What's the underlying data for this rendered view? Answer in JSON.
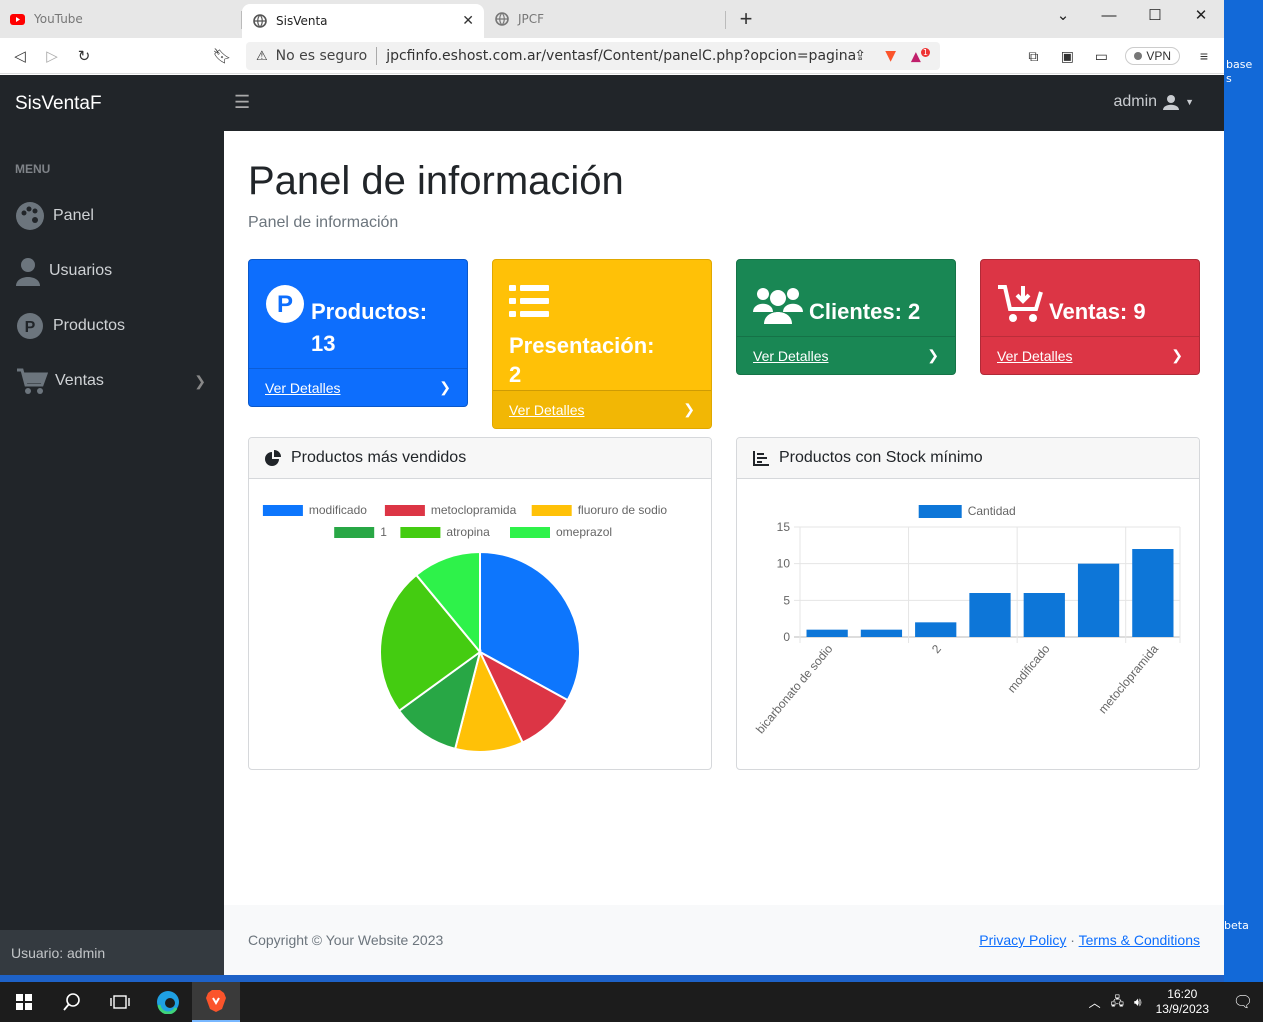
{
  "desktop": {
    "label_top": "base",
    "label_top2": "s",
    "label_bottom": "beta"
  },
  "browser": {
    "tabs": [
      {
        "title": "YouTube",
        "icon": "youtube-icon"
      },
      {
        "title": "SisVenta",
        "icon": "globe-icon",
        "active": true
      },
      {
        "title": "JPCF",
        "icon": "globe-icon"
      }
    ],
    "security_label": "No es seguro",
    "url": "jpcfinfo.eshost.com.ar/ventasf/Content/panelC.php?opcion=pagina",
    "vpn_label": "VPN",
    "notification_count": "1"
  },
  "sidebar": {
    "brand": "SisVentaF",
    "menu_heading": "MENU",
    "items": [
      {
        "label": "Panel",
        "icon": "palette-icon"
      },
      {
        "label": "Usuarios",
        "icon": "user-icon"
      },
      {
        "label": "Productos",
        "icon": "product-p-icon"
      },
      {
        "label": "Ventas",
        "icon": "cart-icon"
      }
    ],
    "footer": "Usuario: admin"
  },
  "topnav": {
    "user": "admin"
  },
  "main": {
    "title": "Panel de información",
    "subtitle": "Panel de información",
    "cards": [
      {
        "label": "Productos: 13",
        "link": "Ver Detalles",
        "color": "#0d6efd"
      },
      {
        "label": "Presentación:",
        "label2": "2",
        "link": "Ver Detalles",
        "color": "#ffc107"
      },
      {
        "label": "Clientes: 2",
        "link": "Ver Detalles",
        "color": "#198754"
      },
      {
        "label": "Ventas: 9",
        "link": "Ver Detalles",
        "color": "#dc3545"
      }
    ],
    "pie_title": "Productos más vendidos",
    "bar_title": "Productos con Stock mínimo"
  },
  "chart_data": [
    {
      "type": "pie",
      "legend_position": "top",
      "categories": [
        "modificado",
        "metoclopramida",
        "fluoruro de sodio",
        "1",
        "atropina",
        "omeprazol"
      ],
      "values": [
        33,
        10,
        11,
        11,
        24,
        11
      ],
      "colors": [
        "#0d76fd",
        "#dc3545",
        "#ffc107",
        "#28a745",
        "#44cc11",
        "#2ef24a"
      ]
    },
    {
      "type": "bar",
      "legend_position": "top",
      "series": [
        {
          "name": "Cantidad",
          "values": [
            1,
            1,
            2,
            6,
            6,
            10,
            12
          ],
          "color": "#0d76d8"
        }
      ],
      "tick_labels": [
        "bicarbonato de sodio",
        "",
        "2",
        "",
        "modificado",
        "",
        "metoclopramida"
      ],
      "ylim": [
        0,
        15
      ],
      "yticks": [
        0,
        5,
        10,
        15
      ],
      "grid": true
    }
  ],
  "footer": {
    "copyright": "Copyright © Your Website 2023",
    "privacy": "Privacy Policy",
    "sep": "·",
    "terms": "Terms & Conditions"
  },
  "taskbar": {
    "time": "16:20",
    "date": "13/9/2023"
  }
}
